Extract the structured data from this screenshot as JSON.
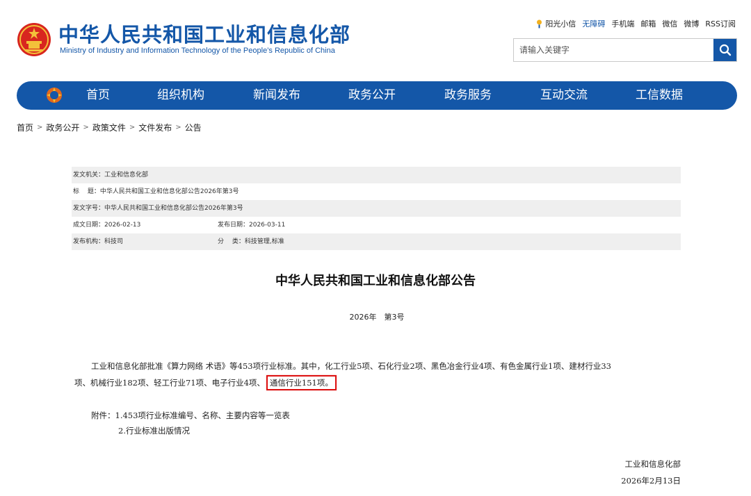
{
  "header": {
    "title": "中华人民共和国工业和信息化部",
    "subtitle": "Ministry of Industry and Information Technology of the People’s Republic of China",
    "top_links": [
      "阳光小信",
      "无障碍",
      "手机端",
      "邮箱",
      "微信",
      "微博",
      "RSS订阅"
    ],
    "search_placeholder": "请输入关键字"
  },
  "nav": {
    "items": [
      "首页",
      "组织机构",
      "新闻发布",
      "政务公开",
      "政务服务",
      "互动交流",
      "工信数据"
    ]
  },
  "breadcrumb": [
    "首页",
    "政务公开",
    "政策文件",
    "文件发布",
    "公告"
  ],
  "meta": {
    "issuer": "发文机关：工业和信息化部",
    "title": "标　 题：中华人民共和国工业和信息化部公告2026年第3号",
    "doc_no": "发文字号：中华人民共和国工业和信息化部公告2026年第3号",
    "written_date": "成文日期：2026-02-13",
    "publish_date": "发布日期：2026-03-11",
    "org": "发布机构：科技司",
    "category": "分　 类：科技管理,标准"
  },
  "article": {
    "title": "中华人民共和国工业和信息化部公告",
    "number": "2026年　第3号",
    "para_line1": "工业和信息化部批准《算力网络 术语》等453项行业标准。其中，化工行业5项、石化行业2项、黑色冶金行业4项、有色金属行业1项、建材行业33",
    "para_line2": "项、机械行业182项、轻工行业71项、电子行业4项、",
    "para_highlight": "通信行业151项。",
    "attachment_1": "附件：1.453项行业标准编号、名称、主要内容等一览表",
    "attachment_2": "2.行业标准出版情况",
    "sign_org": "工业和信息化部",
    "sign_date": "2026年2月13日"
  },
  "colors": {
    "brand_blue": "#1457a8",
    "highlight_red": "#dd1111"
  }
}
